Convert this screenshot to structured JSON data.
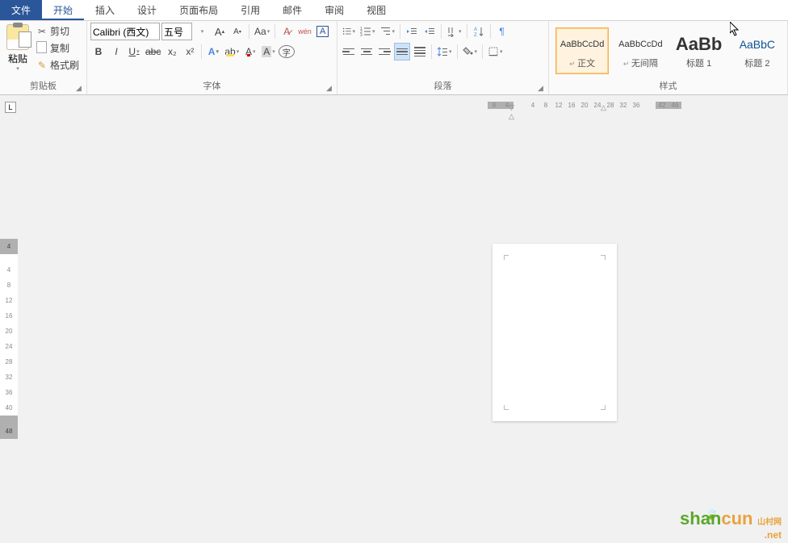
{
  "tabs": {
    "file": "文件",
    "home": "开始",
    "insert": "插入",
    "design": "设计",
    "layout": "页面布局",
    "references": "引用",
    "mail": "邮件",
    "review": "审阅",
    "view": "视图"
  },
  "clipboard": {
    "paste": "粘贴",
    "cut": "剪切",
    "copy": "复制",
    "format_painter": "格式刷",
    "group": "剪贴板"
  },
  "font": {
    "name": "Calibri (西文)",
    "size": "五号",
    "aa": "Aa",
    "bold": "B",
    "italic": "I",
    "underline": "U",
    "strike": "abc",
    "sub": "x₂",
    "sup": "x²",
    "char_a": "A",
    "wen": "wén",
    "group": "字体"
  },
  "paragraph": {
    "group": "段落"
  },
  "styles": {
    "items": [
      {
        "sample": "AaBbCcDd",
        "name": "正文"
      },
      {
        "sample": "AaBbCcDd",
        "name": "无间隔"
      },
      {
        "sample": "AaBb",
        "name": "标题 1"
      },
      {
        "sample": "AaBbC",
        "name": "标题 2"
      }
    ],
    "group": "样式"
  },
  "ruler": {
    "h": [
      "8",
      "4",
      "",
      "4",
      "8",
      "12",
      "16",
      "20",
      "24",
      "28",
      "32",
      "36",
      "",
      "42",
      "46"
    ],
    "v": [
      "4",
      "",
      "4",
      "8",
      "12",
      "16",
      "20",
      "24",
      "28",
      "32",
      "36",
      "40",
      "",
      "48"
    ]
  },
  "watermark": {
    "text1": "shan",
    "text2": "cun",
    "sub": "山村网",
    "net": ".net"
  }
}
